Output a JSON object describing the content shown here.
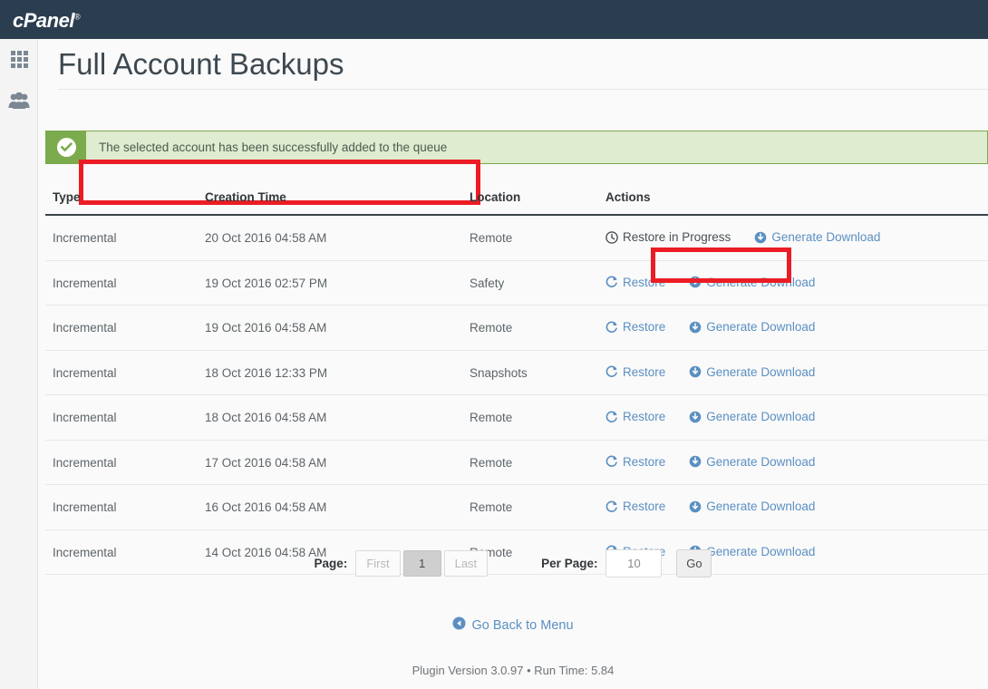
{
  "topbar": {
    "brand": "cPanel",
    "brand_tm": "®"
  },
  "sidebar": {
    "items": [
      {
        "name": "apps-grid",
        "icon": "grid-icon",
        "label": ""
      },
      {
        "name": "users",
        "icon": "users-icon",
        "label": ""
      }
    ]
  },
  "page": {
    "title": "Full Account Backups"
  },
  "alert": {
    "icon": "check-circle-icon",
    "message": "The selected account has been successfully added to the queue",
    "accent": "#7bab4c",
    "background": "#dfecd0",
    "highlight_color": "#ec1c24"
  },
  "table": {
    "headers": [
      "Type",
      "Creation Time",
      "Location",
      "Actions"
    ],
    "rows": [
      {
        "type": "Incremental",
        "creation_time": "20 Oct 2016 04:58 AM",
        "location": "Remote",
        "restore": {
          "label": "Restore in Progress",
          "icon": "clock-icon",
          "disabled": true
        },
        "download": {
          "label": "Generate Download",
          "icon": "download-circle-icon"
        }
      },
      {
        "type": "Incremental",
        "creation_time": "19 Oct 2016 02:57 PM",
        "location": "Safety",
        "restore": {
          "label": "Restore",
          "icon": "refresh-icon",
          "disabled": false
        },
        "download": {
          "label": "Generate Download",
          "icon": "download-circle-icon"
        }
      },
      {
        "type": "Incremental",
        "creation_time": "19 Oct 2016 04:58 AM",
        "location": "Remote",
        "restore": {
          "label": "Restore",
          "icon": "refresh-icon",
          "disabled": false
        },
        "download": {
          "label": "Generate Download",
          "icon": "download-circle-icon"
        }
      },
      {
        "type": "Incremental",
        "creation_time": "18 Oct 2016 12:33 PM",
        "location": "Snapshots",
        "restore": {
          "label": "Restore",
          "icon": "refresh-icon",
          "disabled": false
        },
        "download": {
          "label": "Generate Download",
          "icon": "download-circle-icon"
        }
      },
      {
        "type": "Incremental",
        "creation_time": "18 Oct 2016 04:58 AM",
        "location": "Remote",
        "restore": {
          "label": "Restore",
          "icon": "refresh-icon",
          "disabled": false
        },
        "download": {
          "label": "Generate Download",
          "icon": "download-circle-icon"
        }
      },
      {
        "type": "Incremental",
        "creation_time": "17 Oct 2016 04:58 AM",
        "location": "Remote",
        "restore": {
          "label": "Restore",
          "icon": "refresh-icon",
          "disabled": false
        },
        "download": {
          "label": "Generate Download",
          "icon": "download-circle-icon"
        }
      },
      {
        "type": "Incremental",
        "creation_time": "16 Oct 2016 04:58 AM",
        "location": "Remote",
        "restore": {
          "label": "Restore",
          "icon": "refresh-icon",
          "disabled": false
        },
        "download": {
          "label": "Generate Download",
          "icon": "download-circle-icon"
        }
      },
      {
        "type": "Incremental",
        "creation_time": "14 Oct 2016 04:58 AM",
        "location": "Remote",
        "restore": {
          "label": "Restore",
          "icon": "refresh-icon",
          "disabled": false
        },
        "download": {
          "label": "Generate Download",
          "icon": "download-circle-icon"
        }
      }
    ]
  },
  "pager": {
    "page_label": "Page:",
    "first_label": "First",
    "current_page": "1",
    "last_label": "Last",
    "per_page_label": "Per Page:",
    "per_page_value": "10",
    "go_label": "Go"
  },
  "back": {
    "label": "Go Back to Menu",
    "icon": "arrow-left-circle-icon"
  },
  "footer": {
    "text": "Plugin Version 3.0.97 • Run Time: 5.84"
  },
  "colors": {
    "link": "#5b8fc2",
    "header_bg": "#2b3e50",
    "annotation": "#ec1c24"
  }
}
